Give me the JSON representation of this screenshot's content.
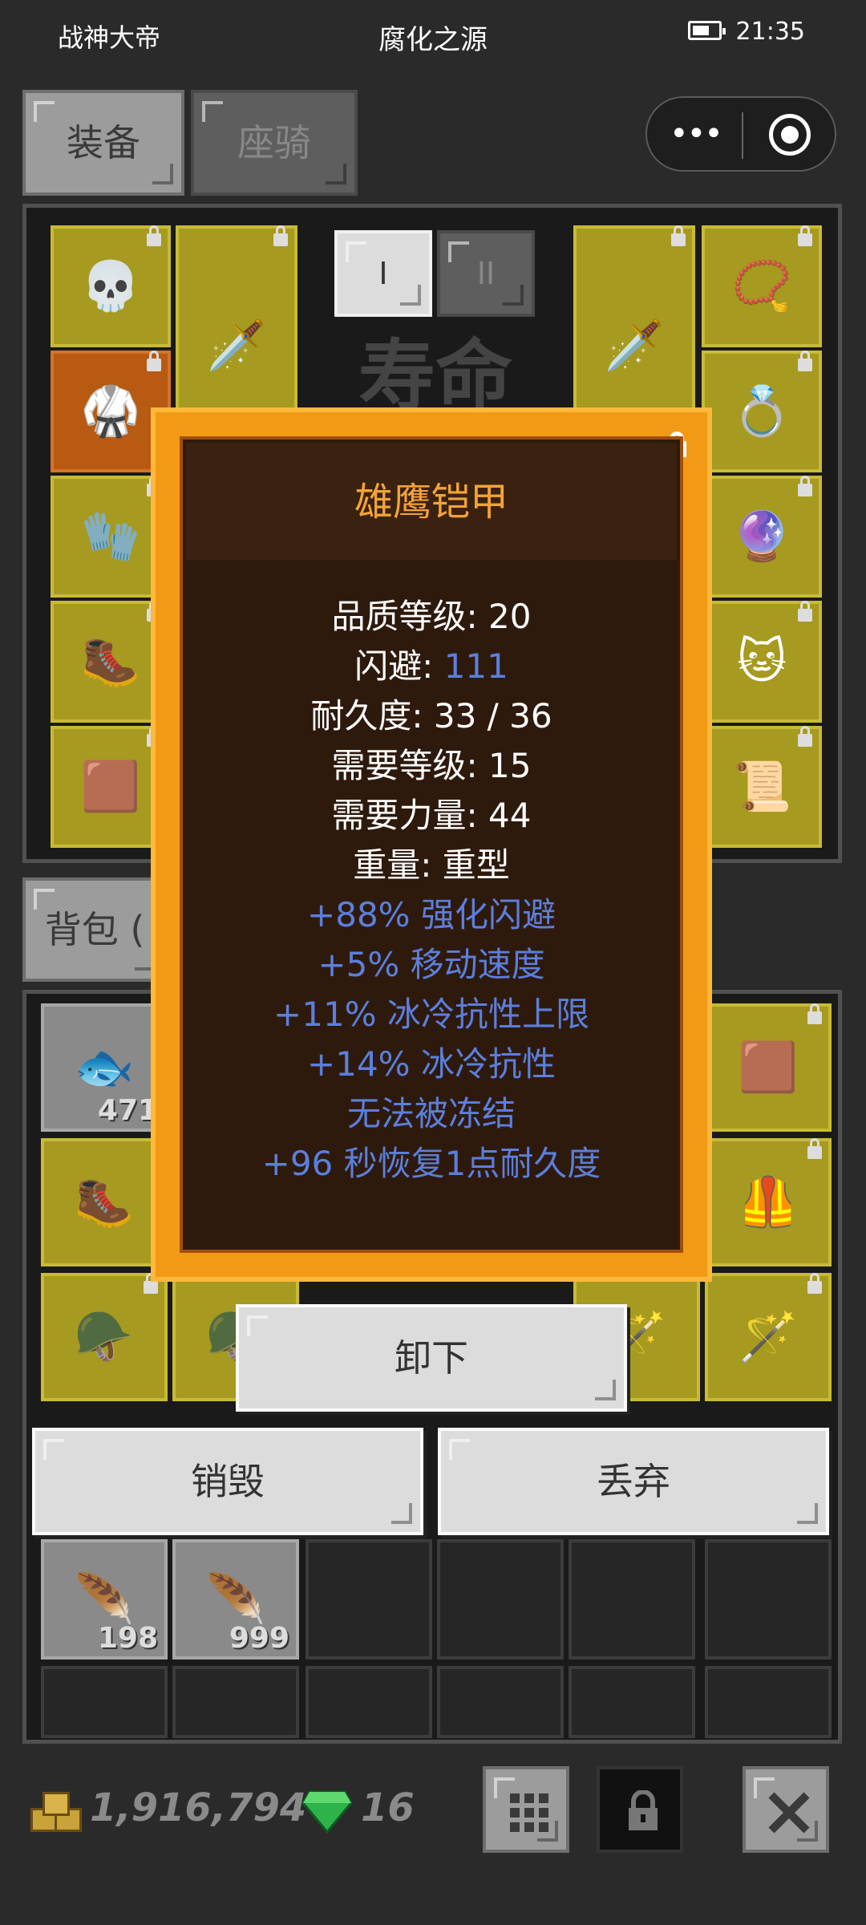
{
  "status_bar": {
    "left_text": "战神大帝",
    "center_text": "腐化之源",
    "time": "21:35"
  },
  "tabs": [
    {
      "label": "装备"
    },
    {
      "label": "座骑"
    }
  ],
  "equip_panel": {
    "page_tabs": [
      "I",
      "II"
    ],
    "banner_text": "寿命"
  },
  "bag_tab": {
    "label": "背包 ("
  },
  "bag_counts": {
    "fish": "471",
    "purple_feather": "198",
    "blue_feather": "999"
  },
  "tooltip": {
    "title": "雄鹰铠甲",
    "quality_label": "品质等级: ",
    "quality_value": "20",
    "dodge_label": "闪避: ",
    "dodge_value": "111",
    "durability_label": "耐久度: ",
    "durability_value": "33 / 36",
    "req_level_label": "需要等级: ",
    "req_level_value": "15",
    "req_str_label": "需要力量: ",
    "req_str_value": "44",
    "weight_label": "重量: ",
    "weight_value": "重型",
    "affixes": [
      "+88% 强化闪避",
      "+5% 移动速度",
      "+11% 冰冷抗性上限",
      "+14% 冰冷抗性",
      "无法被冻结",
      "+96 秒恢复1点耐久度"
    ]
  },
  "actions": {
    "unequip": "卸下",
    "destroy": "销毁",
    "discard": "丢弃"
  },
  "footer": {
    "gold": "1,916,794",
    "gems": "16"
  },
  "colors": {
    "affix_blue": "#5b7fdc",
    "title_orange": "#f2a33a",
    "frame_orange": "#f29a15"
  }
}
